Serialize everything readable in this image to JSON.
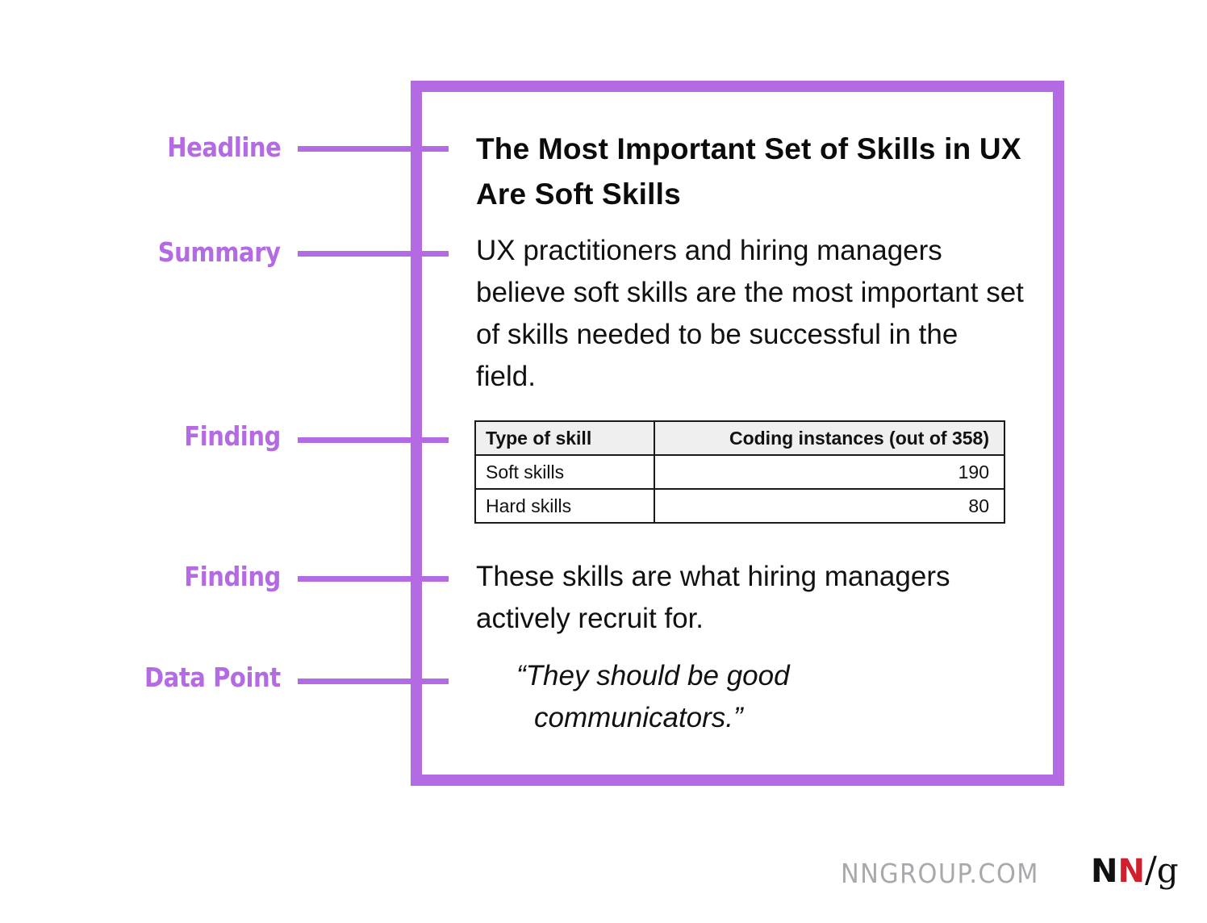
{
  "colors": {
    "accent": "#b36ae3",
    "logo_red": "#d0202e",
    "footer_gray": "#a7a9ac"
  },
  "labels": [
    {
      "text": "Headline"
    },
    {
      "text": "Summary"
    },
    {
      "text": "Finding"
    },
    {
      "text": "Finding"
    },
    {
      "text": "Data Point"
    }
  ],
  "article": {
    "headline": "The Most Important Set of Skills in UX Are Soft Skills",
    "summary": "UX practitioners and hiring managers believe soft skills are the most important set of skills needed to be successful in the field.",
    "table": {
      "headers": [
        "Type of skill",
        "Coding instances (out of 358)"
      ],
      "rows": [
        [
          "Soft skills",
          "190"
        ],
        [
          "Hard skills",
          "80"
        ]
      ]
    },
    "finding": "These skills are what hiring managers actively recruit for.",
    "quote_line1": "“They should be good",
    "quote_line2": "communicators.”"
  },
  "footer": {
    "url": "NNGROUP.COM",
    "logo": {
      "n1": "N",
      "n2": "N",
      "slash": "/",
      "g": "g"
    }
  }
}
